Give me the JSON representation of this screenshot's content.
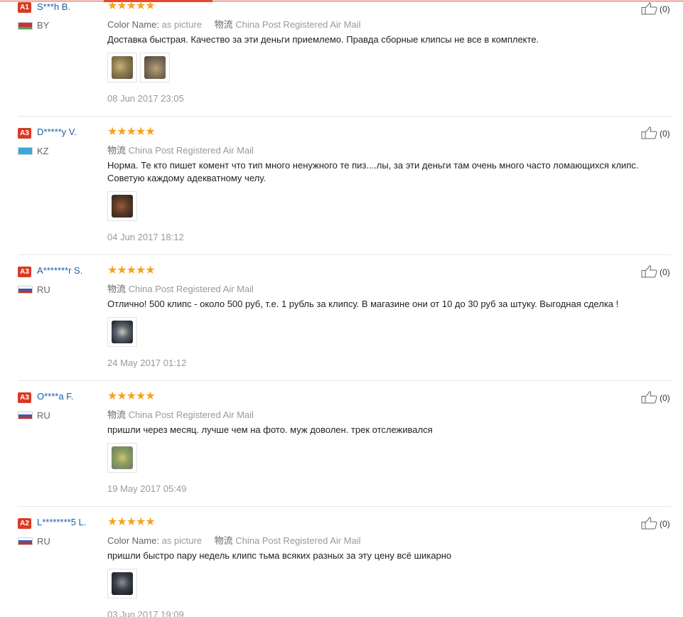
{
  "reviews": [
    {
      "level": "A1",
      "user": "S***h B.",
      "country": "BY",
      "flag_colors": [
        "#c8313e",
        "#c8313e",
        "#4aa657"
      ],
      "rating": "★★★★★",
      "color_label": "Color Name:",
      "color_value": "as picture",
      "shipping_label": "物流",
      "shipping": "China Post Registered Air Mail",
      "text": "Доставка быстрая. Качество за эти деньги приемлемо. Правда сборные клипсы не все в комплекте.",
      "photos": 2,
      "date": "08 Jun 2017 23:05",
      "likes": "(0)"
    },
    {
      "level": "A3",
      "user": "D*****y V.",
      "country": "KZ",
      "flag_colors": [
        "#3aa8d8",
        "#3aa8d8",
        "#3aa8d8"
      ],
      "rating": "★★★★★",
      "shipping_label": "物流",
      "shipping": "China Post Registered Air Mail",
      "text": "Норма. Те кто пишет комент что тип много ненужного те пиз....лы, за эти деньги там очень много часто ломающихся клипс. Советую каждому адекватному челу.",
      "photos": 1,
      "date": "04 Jun 2017 18:12",
      "likes": "(0)"
    },
    {
      "level": "A3",
      "user": "A*******r S.",
      "country": "RU",
      "flag_colors": [
        "#ffffff",
        "#2f5fbf",
        "#d52b1e"
      ],
      "rating": "★★★★★",
      "shipping_label": "物流",
      "shipping": "China Post Registered Air Mail",
      "text": "Отлично! 500 клипс - около 500 руб, т.е. 1 рубль за клипсу. В магазине они от 10 до 30 руб за штуку. Выгодная сделка !",
      "photos": 1,
      "date": "24 May 2017 01:12",
      "likes": "(0)"
    },
    {
      "level": "A3",
      "user": "O****a F.",
      "country": "RU",
      "flag_colors": [
        "#ffffff",
        "#2f5fbf",
        "#d52b1e"
      ],
      "rating": "★★★★★",
      "shipping_label": "物流",
      "shipping": "China Post Registered Air Mail",
      "text": "пришли через месяц. лучше чем на фото. муж доволен. трек отслеживался",
      "photos": 1,
      "date": "19 May 2017 05:49",
      "likes": "(0)"
    },
    {
      "level": "A2",
      "user": "L********5 L.",
      "country": "RU",
      "flag_colors": [
        "#ffffff",
        "#2f5fbf",
        "#d52b1e"
      ],
      "rating": "★★★★★",
      "color_label": "Color Name:",
      "color_value": "as picture",
      "shipping_label": "物流",
      "shipping": "China Post Registered Air Mail",
      "text": "пришли быстро пару недель клипс тьма всяких разных за эту цену всё шикарно",
      "photos": 1,
      "date": "03 Jun 2017 19:09",
      "likes": "(0)"
    }
  ]
}
